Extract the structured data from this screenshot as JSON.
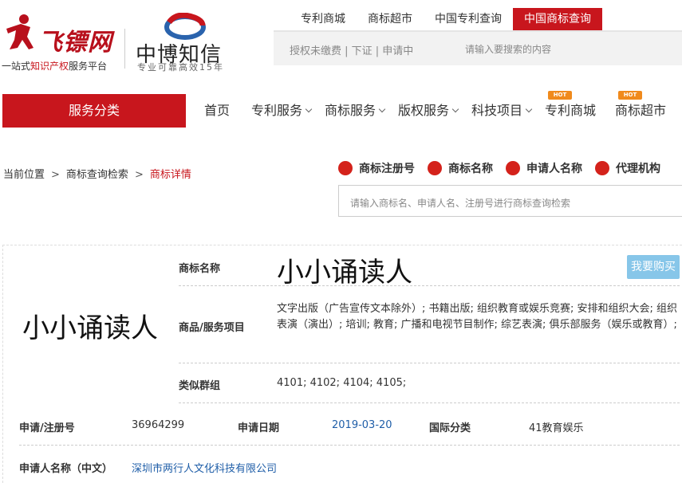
{
  "header": {
    "logo1": {
      "name": "飞镖网",
      "tagline_prefix": "一站式",
      "tagline_highlight": "知识产权",
      "tagline_suffix": "服务平台"
    },
    "logo2": {
      "name": "中博知信",
      "tagline": "专业可靠高效15年"
    },
    "top_links": [
      {
        "label": "专利商城",
        "active": false
      },
      {
        "label": "商标超市",
        "active": false
      },
      {
        "label": "中国专利查询",
        "active": false
      },
      {
        "label": "中国商标查询",
        "active": true
      }
    ],
    "topbar_links": "授权未缴费 | 下证 | 申请中",
    "topbar_search_placeholder": "请输入要搜索的内容"
  },
  "nav": {
    "category_label": "服务分类",
    "items": [
      {
        "label": "首页",
        "has_dropdown": false,
        "hot": false
      },
      {
        "label": "专利服务",
        "has_dropdown": true,
        "hot": false
      },
      {
        "label": "商标服务",
        "has_dropdown": true,
        "hot": false
      },
      {
        "label": "版权服务",
        "has_dropdown": true,
        "hot": false
      },
      {
        "label": "科技项目",
        "has_dropdown": true,
        "hot": false
      },
      {
        "label": "专利商城",
        "has_dropdown": false,
        "hot": true
      },
      {
        "label": "商标超市",
        "has_dropdown": false,
        "hot": true
      }
    ],
    "hot_label": "HOT"
  },
  "breadcrumb": {
    "items": [
      "当前位置",
      "商标查询检索",
      "商标详情"
    ],
    "separator": ">"
  },
  "search": {
    "types": [
      "商标注册号",
      "商标名称",
      "申请人名称",
      "代理机构"
    ],
    "placeholder": "请输入商标名、申请人名、注册号进行商标查询检索"
  },
  "detail": {
    "image_text": "小小诵读人",
    "name_label": "商标名称",
    "name_value": "小小诵读人",
    "buy_label": "我要购买",
    "goods_label": "商品/服务项目",
    "goods_value": "文字出版（广告宣传文本除外）; 书籍出版; 组织教育或娱乐竞赛; 安排和组织大会; 组织表演（演出）; 培训; 教育; 广播和电视节目制作; 综艺表演; 俱乐部服务（娱乐或教育）;",
    "similar_label": "类似群组",
    "similar_value": "4101; 4102; 4104; 4105;",
    "reg_no_label": "申请/注册号",
    "reg_no_value": "36964299",
    "apply_date_label": "申请日期",
    "apply_date_value": "2019-03-20",
    "intl_class_label": "国际分类",
    "intl_class_value": "41教育娱乐",
    "applicant_label": "申请人名称（中文）",
    "applicant_value": "深圳市两行人文化科技有限公司"
  },
  "colors": {
    "brand_red": "#c8161d",
    "dot_red": "#d4221b",
    "buy_button": "#87c6e9",
    "link_blue": "#1f5ea8",
    "hot_orange": "#f08a1c"
  }
}
